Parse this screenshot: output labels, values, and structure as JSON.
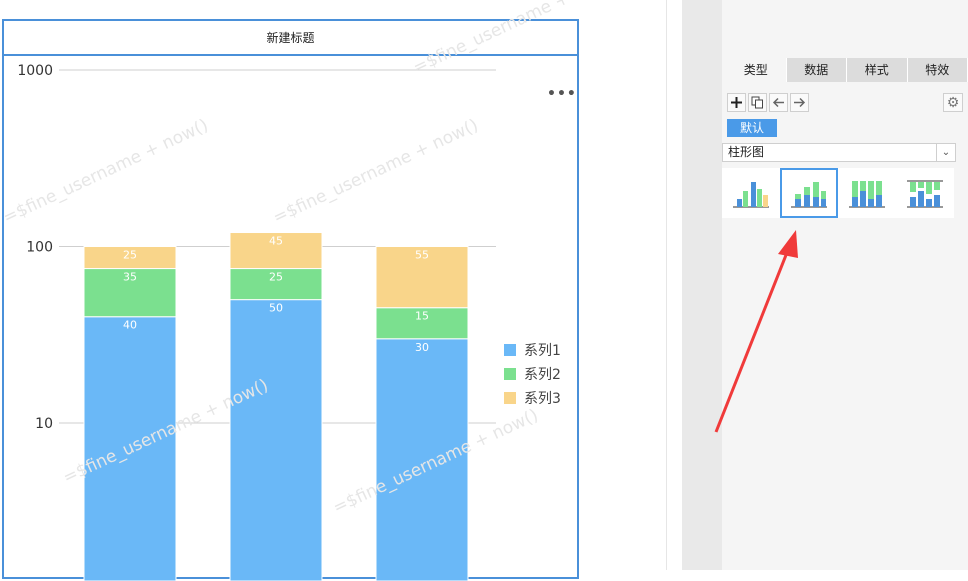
{
  "chart_data": {
    "type": "bar",
    "stacked": true,
    "scale": "log",
    "title": "新建标题",
    "categories": [
      "",
      "",
      ""
    ],
    "series": [
      {
        "name": "系列1",
        "values": [
          40,
          50,
          30
        ],
        "color": "#6ab8f7"
      },
      {
        "name": "系列2",
        "values": [
          35,
          25,
          15
        ],
        "color": "#7be08f"
      },
      {
        "name": "系列3",
        "values": [
          25,
          45,
          55
        ],
        "color": "#f9d58a"
      }
    ],
    "yticks": [
      "10",
      "100",
      "1000"
    ],
    "ylim": [
      1,
      1000
    ],
    "grid": true,
    "legend_position": "right"
  },
  "menu_icon": "more-dots-icon",
  "watermarks": [
    "=$fine_username + now()",
    "=$fine_username + now()",
    "=$fine_username + now()",
    "=$fine_username + now()",
    "=$fine_username + now()"
  ],
  "panel": {
    "tabs": [
      "类型",
      "数据",
      "样式",
      "特效"
    ],
    "active_tab": "类型",
    "toolbar_icons": [
      "add-icon",
      "copy-icon",
      "arrow-left-icon",
      "arrow-right-icon"
    ],
    "default_tag": "默认",
    "chart_type_value": "柱形图",
    "chart_thumbnails": [
      "clustered-bar",
      "stacked-bar",
      "percent-stacked-bar",
      "custom-stacked-bar"
    ],
    "selected_thumbnail": "stacked-bar"
  },
  "colors": {
    "frame_border": "#4a90d9",
    "accent": "#4a9ae8",
    "arrow": "#f03a3a"
  }
}
